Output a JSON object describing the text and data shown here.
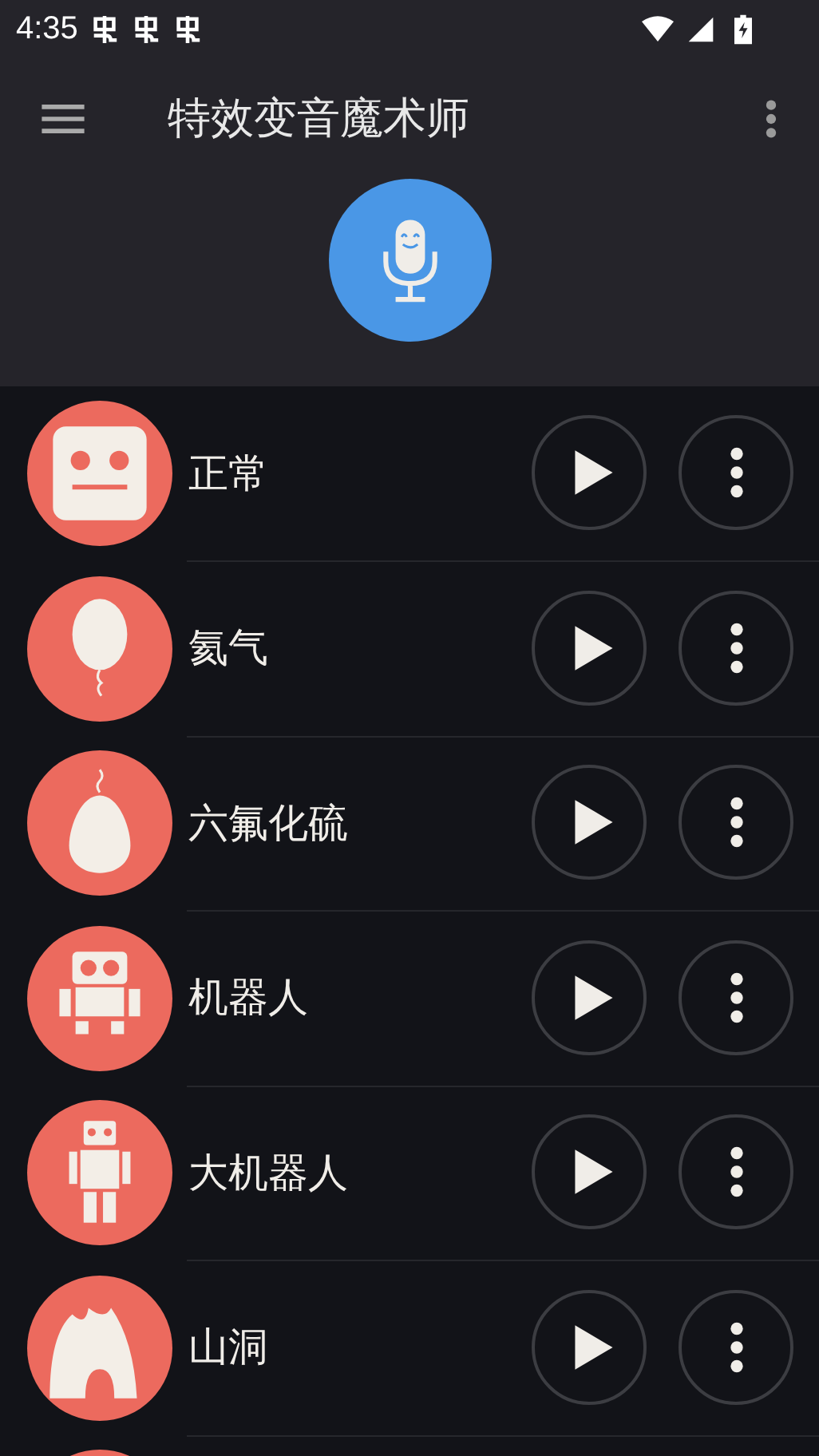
{
  "status_bar": {
    "time": "4:35"
  },
  "toolbar": {
    "title": "特效变音魔术师"
  },
  "effects": [
    {
      "label": "正常",
      "kind": "face"
    },
    {
      "label": "氦气",
      "kind": "balloon"
    },
    {
      "label": "六氟化硫",
      "kind": "egg"
    },
    {
      "label": "机器人",
      "kind": "robot"
    },
    {
      "label": "大机器人",
      "kind": "tall"
    },
    {
      "label": "山洞",
      "kind": "cave"
    }
  ]
}
